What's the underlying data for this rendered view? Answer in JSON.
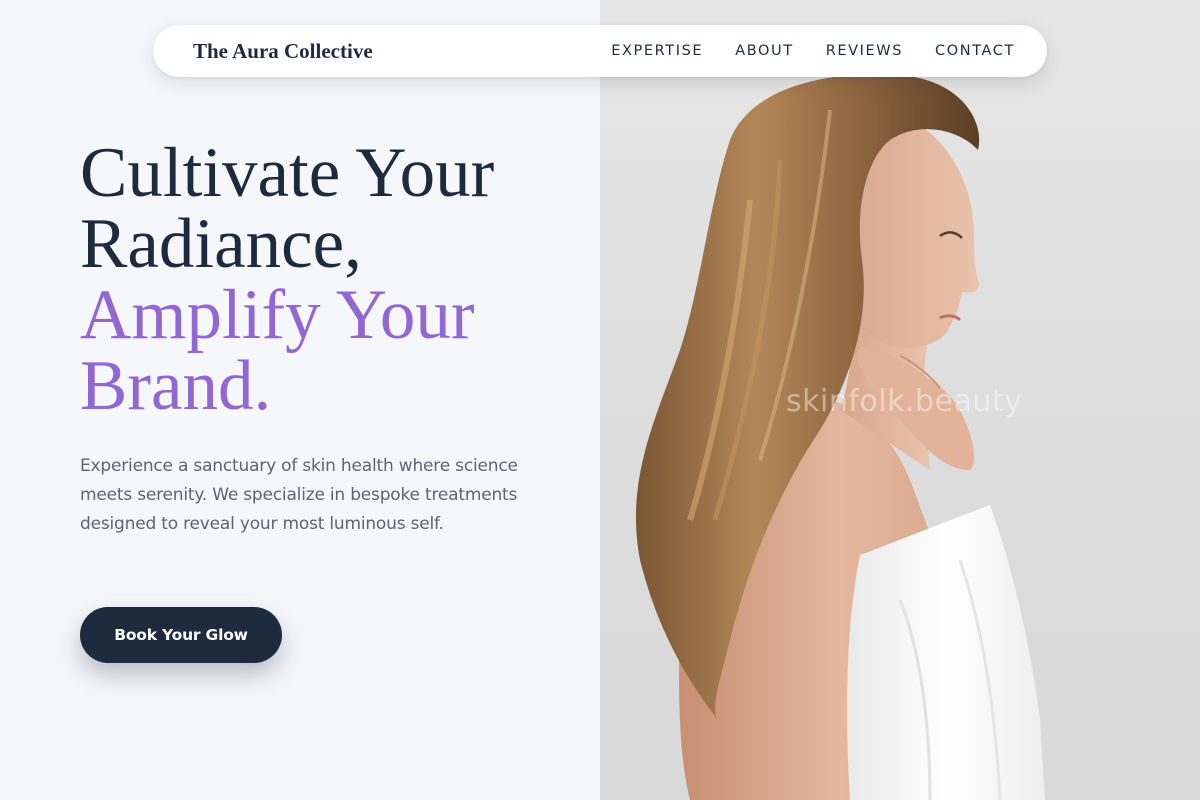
{
  "nav": {
    "brand": "The Aura Collective",
    "links": [
      "EXPERTISE",
      "ABOUT",
      "REVIEWS",
      "CONTACT"
    ]
  },
  "hero": {
    "headline_dark_line1": "Cultivate Your",
    "headline_dark_line2": "Radiance,",
    "headline_accent_line1": "Amplify Your",
    "headline_accent_line2": "Brand.",
    "description": "Experience a sanctuary of skin health where science meets serenity. We specialize in bespoke treatments designed to reveal your most luminous self.",
    "cta_label": "Book Your Glow"
  },
  "image": {
    "watermark": "skinfolk.beauty"
  },
  "colors": {
    "navy": "#1e2a3d",
    "accent_purple": "#9067d3",
    "body_text": "#5b6475",
    "panel_bg": "#f6f7fb"
  }
}
